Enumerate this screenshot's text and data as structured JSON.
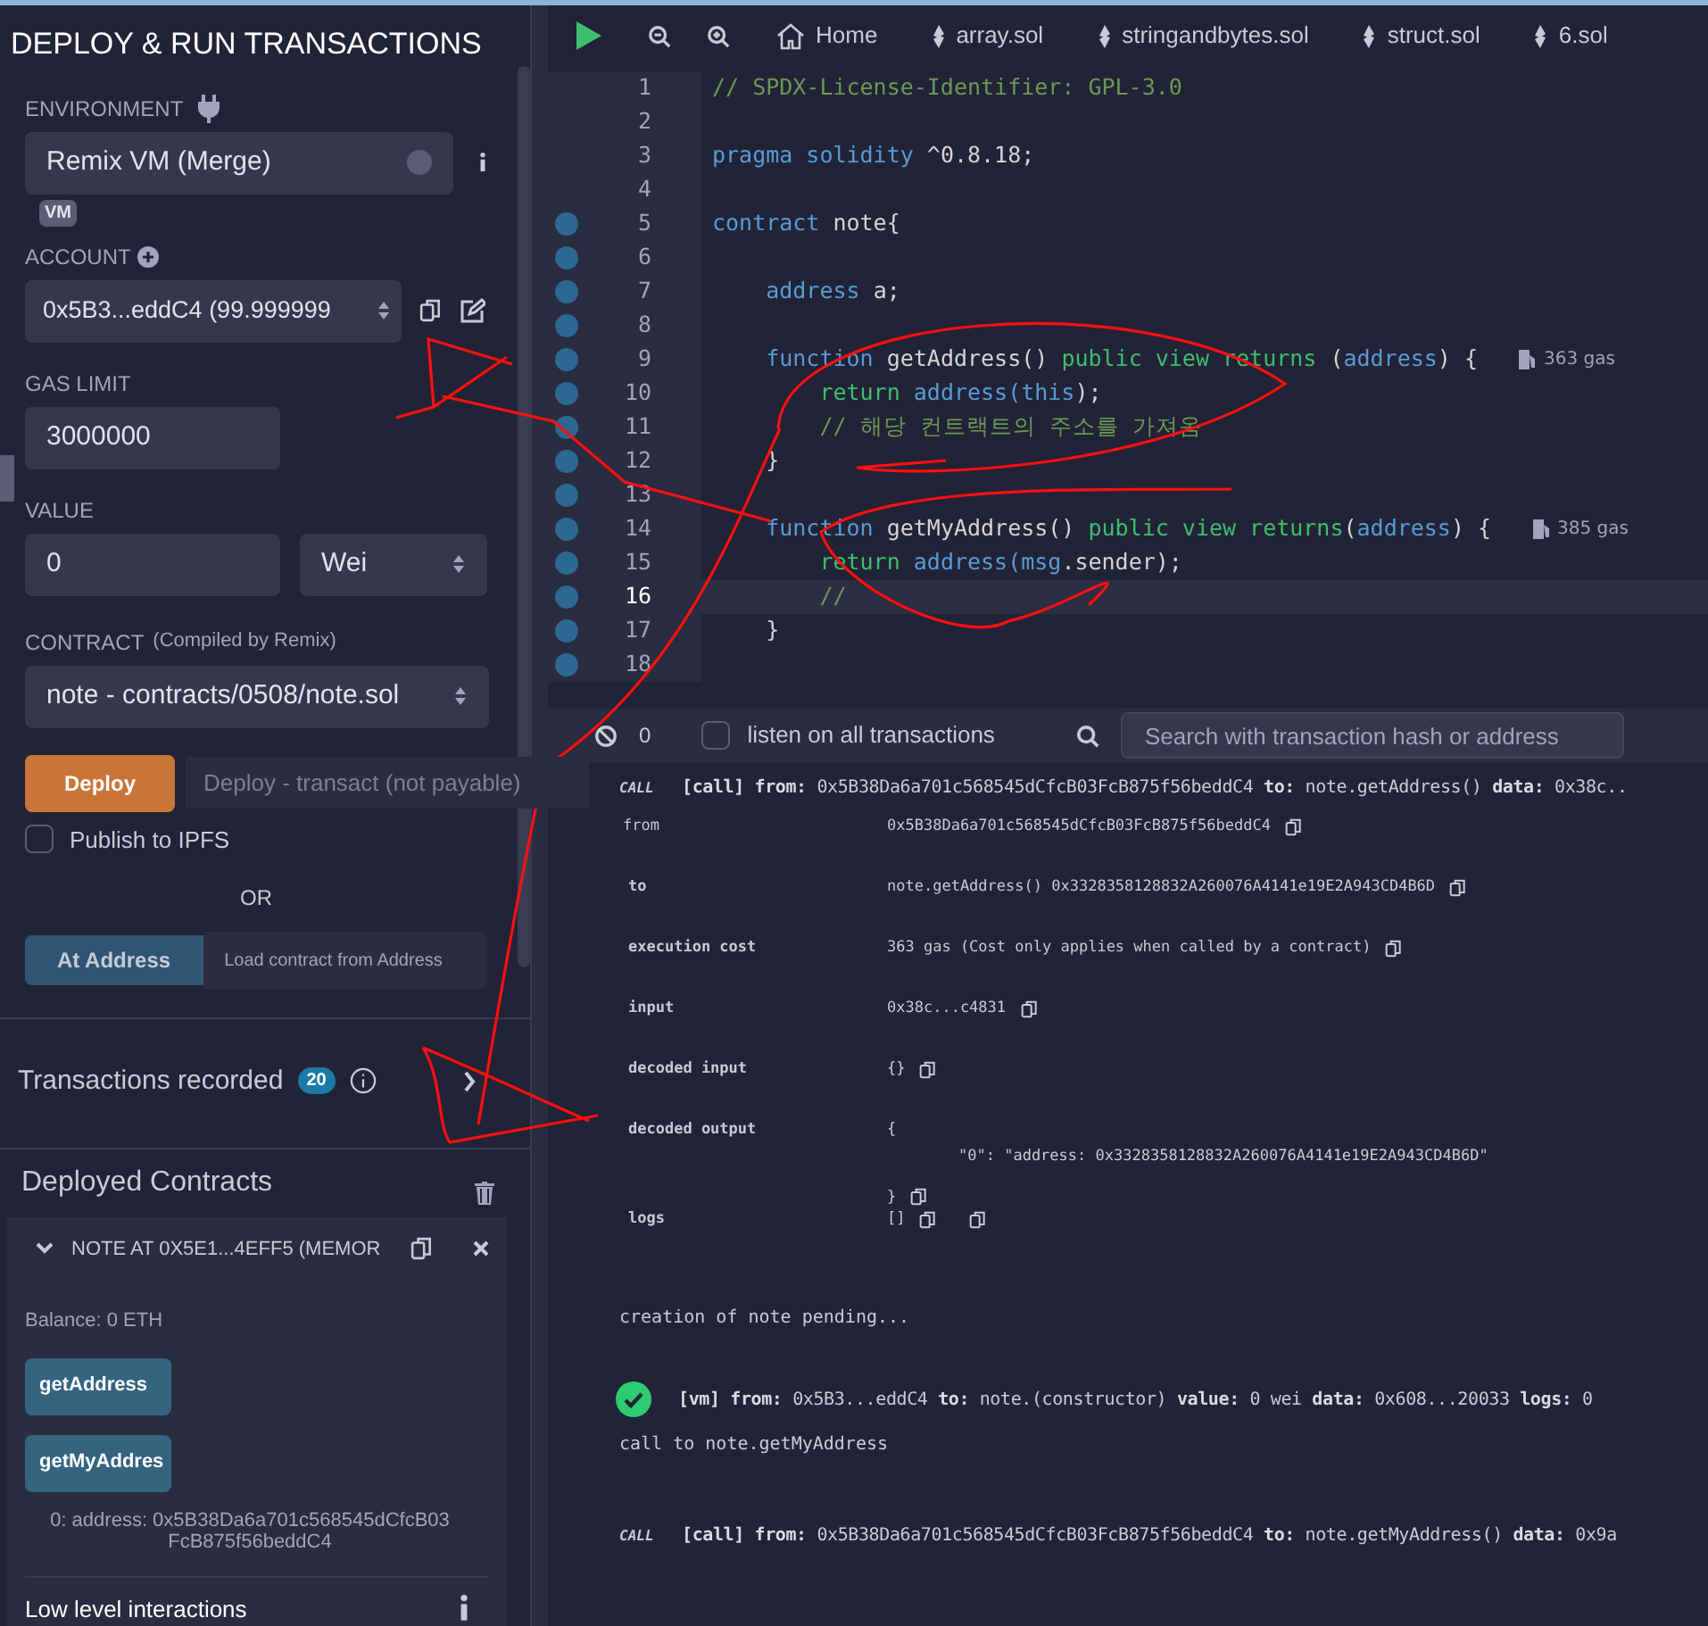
{
  "panel": {
    "title": "DEPLOY & RUN TRANSACTIONS",
    "environment": {
      "label": "ENVIRONMENT",
      "value": "Remix VM (Merge)",
      "badge": "VM"
    },
    "account": {
      "label": "ACCOUNT",
      "value": "0x5B3...eddC4 (99.999999"
    },
    "gas_limit": {
      "label": "GAS LIMIT",
      "value": "3000000"
    },
    "value": {
      "label": "VALUE",
      "amount": "0",
      "unit": "Wei"
    },
    "contract": {
      "label": "CONTRACT",
      "note": "(Compiled by Remix)",
      "value": "note - contracts/0508/note.sol"
    },
    "deploy": {
      "button": "Deploy",
      "hint": "Deploy - transact (not payable)"
    },
    "publish": {
      "label": "Publish to IPFS",
      "checked": false
    },
    "or": "OR",
    "at_address": {
      "button": "At Address",
      "placeholder": "Load contract from Address"
    },
    "transactions": {
      "label": "Transactions recorded",
      "count": "20"
    },
    "deployed": {
      "title": "Deployed Contracts",
      "instance": "NOTE AT 0X5E1...4EFF5 (MEMOR",
      "expanded": true,
      "balance": "Balance: 0 ETH",
      "functions": [
        {
          "label": "getAddress"
        },
        {
          "label": "getMyAddres",
          "result": "0:  address: 0x5B38Da6a701c568545dCfcB03FcB875f56beddC4"
        }
      ],
      "low_level": "Low level interactions"
    }
  },
  "tabs": [
    {
      "label": "Home",
      "kind": "home",
      "selected": false
    },
    {
      "label": "array.sol",
      "kind": "file",
      "selected": false
    },
    {
      "label": "stringandbytes.sol",
      "kind": "file",
      "selected": false
    },
    {
      "label": "struct.sol",
      "kind": "file",
      "selected": false
    },
    {
      "label": "6.sol",
      "kind": "file",
      "selected": false
    }
  ],
  "editor": {
    "lines": [
      {
        "number": "1",
        "marker": false,
        "selected": false,
        "tokens": [
          {
            "text": "// SPDX-License-Identifier: GPL-3.0",
            "kind": "comment"
          }
        ]
      },
      {
        "number": "2",
        "marker": false,
        "selected": false
      },
      {
        "number": "3",
        "marker": false,
        "selected": false,
        "tokens": [
          {
            "text": "pragma solidity ",
            "kind": "keyword"
          },
          {
            "text": "^0.8.18;",
            "kind": "plain"
          }
        ]
      },
      {
        "number": "4",
        "marker": false,
        "selected": false
      },
      {
        "number": "5",
        "marker": true,
        "selected": false,
        "tokens": [
          {
            "text": "contract ",
            "kind": "keyword"
          },
          {
            "text": "note{",
            "kind": "plain"
          }
        ]
      },
      {
        "number": "6",
        "marker": true,
        "selected": false
      },
      {
        "number": "7",
        "marker": true,
        "selected": false,
        "tokens": [
          {
            "text": "    address ",
            "kind": "keyword"
          },
          {
            "text": "a;",
            "kind": "plain"
          }
        ]
      },
      {
        "number": "8",
        "marker": true,
        "selected": false
      },
      {
        "number": "9",
        "marker": true,
        "selected": false,
        "tokens": [
          {
            "text": "    function ",
            "kind": "keyword"
          },
          {
            "text": "getAddress() ",
            "kind": "plain"
          },
          {
            "text": "public view returns ",
            "kind": "modifier"
          },
          {
            "text": "(",
            "kind": "plain"
          },
          {
            "text": "address",
            "kind": "keyword"
          },
          {
            "text": ") {",
            "kind": "plain"
          }
        ],
        "gas": "363 gas"
      },
      {
        "number": "10",
        "marker": true,
        "selected": false,
        "tokens": [
          {
            "text": "        return ",
            "kind": "modifier"
          },
          {
            "text": "address(",
            "kind": "keyword"
          },
          {
            "text": "this",
            "kind": "keyword"
          },
          {
            "text": ");",
            "kind": "plain"
          }
        ]
      },
      {
        "number": "11",
        "marker": true,
        "selected": false,
        "tokens": [
          {
            "text": "        // 해당 컨트랙트의 주소를 가져옴",
            "kind": "comment"
          }
        ]
      },
      {
        "number": "12",
        "marker": true,
        "selected": false,
        "tokens": [
          {
            "text": "    }",
            "kind": "plain"
          }
        ]
      },
      {
        "number": "13",
        "marker": true,
        "selected": false
      },
      {
        "number": "14",
        "marker": true,
        "selected": false,
        "tokens": [
          {
            "text": "    function ",
            "kind": "keyword"
          },
          {
            "text": "getMyAddress() ",
            "kind": "plain"
          },
          {
            "text": "public view returns",
            "kind": "modifier"
          },
          {
            "text": "(",
            "kind": "plain"
          },
          {
            "text": "address",
            "kind": "keyword"
          },
          {
            "text": ") {",
            "kind": "plain"
          }
        ],
        "gas": "385 gas"
      },
      {
        "number": "15",
        "marker": true,
        "selected": false,
        "tokens": [
          {
            "text": "        return ",
            "kind": "modifier"
          },
          {
            "text": "address(",
            "kind": "keyword"
          },
          {
            "text": "msg",
            "kind": "keyword"
          },
          {
            "text": ".sender);",
            "kind": "plain"
          }
        ]
      },
      {
        "number": "16",
        "marker": true,
        "selected": true,
        "tokens": [
          {
            "text": "        //",
            "kind": "comment"
          }
        ]
      },
      {
        "number": "17",
        "marker": true,
        "selected": false,
        "tokens": [
          {
            "text": "    }",
            "kind": "plain"
          }
        ]
      },
      {
        "number": "18",
        "marker": true,
        "selected": false
      }
    ]
  },
  "terminal": {
    "count": "0",
    "listen": {
      "label": "listen on all transactions",
      "checked": false
    },
    "search": {
      "placeholder": "Search with transaction hash or address"
    },
    "log": [
      {
        "kind": "call",
        "tag": "CALL",
        "title": "[call]",
        "fields": [
          {
            "label": "from:",
            "value": "0x5B38Da6a701c568545dCfcB03FcB875f56beddC4"
          },
          {
            "label": "to:",
            "value": "note.getAddress()"
          },
          {
            "label": "data:",
            "value": "0x38c.."
          }
        ]
      },
      {
        "kind": "details",
        "rows": [
          {
            "key": "from",
            "bold": false,
            "value": [
              "0x5B38Da6a701c568545dCfcB03FcB875f56beddC4"
            ],
            "second_copy": false
          },
          {
            "key": "to",
            "bold": true,
            "value": [
              "note.getAddress() 0x3328358128832A260076A4141e19E2A943CD4B6D"
            ],
            "second_copy": false
          },
          {
            "key": "execution cost",
            "bold": true,
            "value": [
              "363 gas (Cost only applies when called by a contract)"
            ],
            "second_copy": false
          },
          {
            "key": "input",
            "bold": true,
            "value": [
              "0x38c...c4831"
            ],
            "second_copy": false
          },
          {
            "key": "decoded input",
            "bold": true,
            "value": [
              "{}"
            ],
            "second_copy": false
          },
          {
            "key": "decoded output",
            "bold": true,
            "value": [
              "{",
              "\"0\": \"address: 0x3328358128832A260076A4141e19E2A943CD4B6D\"",
              "}"
            ],
            "second_copy": false
          },
          {
            "key": "logs",
            "bold": true,
            "value": [
              "[]"
            ],
            "second_copy": true
          }
        ]
      },
      {
        "kind": "text",
        "text": "creation of note pending..."
      },
      {
        "kind": "vm",
        "title": "[vm]",
        "fields": [
          {
            "label": "from:",
            "value": "0x5B3...eddC4"
          },
          {
            "label": "to:",
            "value": "note.(constructor)"
          },
          {
            "label": "value:",
            "value": "0 wei"
          },
          {
            "label": "data:",
            "value": "0x608...20033"
          },
          {
            "label": "logs:",
            "value": "0"
          }
        ]
      },
      {
        "kind": "text",
        "text": "call to note.getMyAddress"
      },
      {
        "kind": "call",
        "tag": "CALL",
        "title": "[call]",
        "fields": [
          {
            "label": "from:",
            "value": "0x5B38Da6a701c568545dCfcB03FcB875f56beddC4"
          },
          {
            "label": "to:",
            "value": "note.getMyAddress()"
          },
          {
            "label": "data:",
            "value": "0x9a"
          }
        ]
      }
    ]
  }
}
